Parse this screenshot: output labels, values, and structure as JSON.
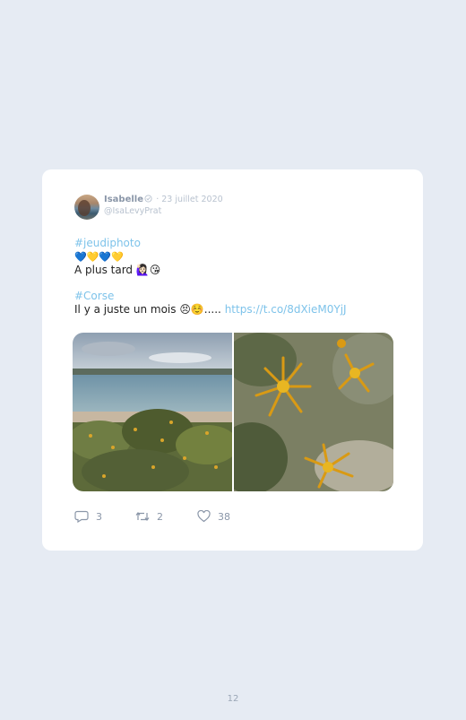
{
  "tweet": {
    "name": "Isabelle",
    "date": "· 23 juillet 2020",
    "handle": "@IsaLevyPrat",
    "hashtag1": "#jeudiphoto",
    "hearts": "💙💛💙💛",
    "later": "A plus tard 🙋🏻‍♀️😘",
    "hashtag2": "#Corse",
    "line_prefix": "Il y a juste un mois 😣☺️.....",
    "link": "https://t.co/8dXieM0YjJ",
    "replies": "3",
    "retweets": "2",
    "likes": "38"
  },
  "icons": {
    "verified": "verified-icon",
    "reply": "reply-icon",
    "retweet": "retweet-icon",
    "like": "heart-icon"
  },
  "page": {
    "number": "12"
  },
  "colors": {
    "link": "#7ec3ea",
    "background": "#e6ebf3",
    "meta": "#8a96a8"
  }
}
